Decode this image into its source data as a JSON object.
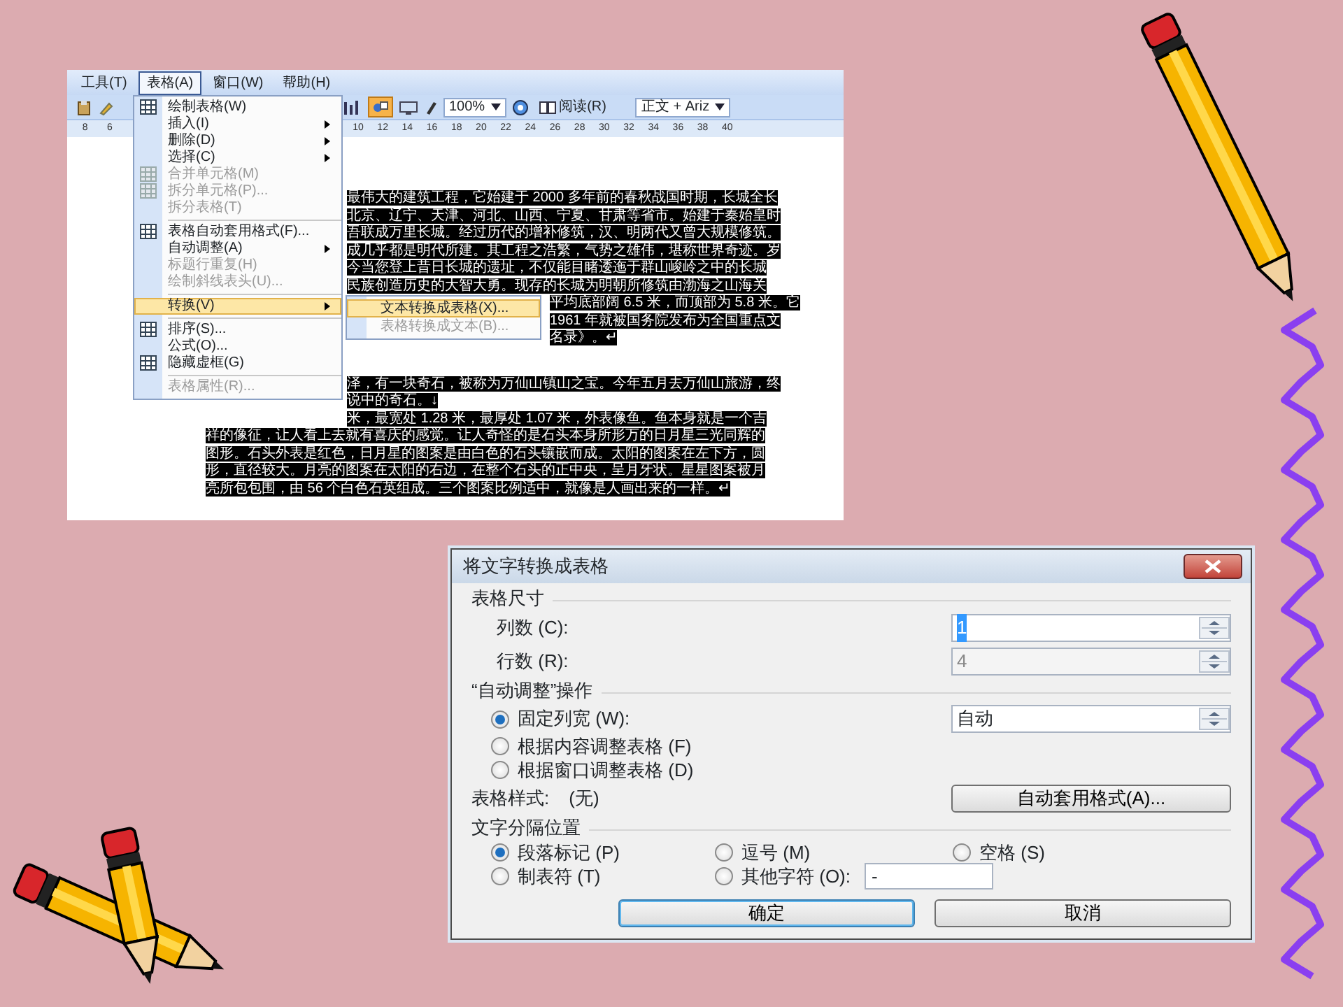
{
  "word_window": {
    "menu_bar": [
      {
        "label": "工具(T)",
        "selected": false
      },
      {
        "label": "表格(A)",
        "selected": true
      },
      {
        "label": "窗口(W)",
        "selected": false
      },
      {
        "label": "帮助(H)",
        "selected": false
      }
    ],
    "toolbar": {
      "zoom": "100%",
      "read_button": "阅读(R)",
      "style_field": "正文 + Ariz"
    },
    "ruler": {
      "left_ticks": [
        "8",
        "6"
      ],
      "ticks": [
        "10",
        "12",
        "14",
        "16",
        "18",
        "20",
        "22",
        "24",
        "26",
        "28",
        "30",
        "32",
        "34",
        "36",
        "38",
        "40"
      ]
    },
    "document": {
      "paragraphs": [
        {
          "lines": [
            {
              "kind": "beside_menu",
              "text": "最伟大的建筑工程，它始建于 2000 多年前的春秋战国时期，长城全长"
            },
            {
              "kind": "beside_menu",
              "text": "北京、辽宁、天津、河北、山西、宁夏、甘肃等省市。始建于秦始皇时"
            },
            {
              "kind": "beside_menu",
              "text": "吾联成万里长城。经过历代的增补修筑，汉、明两代又曾大规模修筑。"
            },
            {
              "kind": "beside_menu",
              "text": "成几乎都是明代所建。其工程之浩繁，气势之雄伟，堪称世界奇迹。岁"
            },
            {
              "kind": "beside_menu",
              "text": "今当您登上昔日长城的遗址，不仅能目睹逶迤于群山峻岭之中的长城"
            },
            {
              "kind": "beside_menu",
              "text": "民族创造历史的大智大勇。现存的长城为明朝所修筑由渤海之山海关"
            },
            {
              "kind": "beside_submenu",
              "text": "平均底部阔 6.5 米，而顶部为 5.8 米。它"
            },
            {
              "kind": "beside_submenu",
              "text": "1961 年就被国务院发布为全国重点文"
            },
            {
              "kind": "beside_submenu",
              "text": "名录》。↵"
            }
          ]
        },
        {
          "lines": [
            {
              "kind": "beside_menu",
              "text": "泽，有一块奇石，被称为万仙山镇山之宝。今年五月去万仙山旅游，终"
            },
            {
              "kind": "beside_menu",
              "text": "说中的奇石。↓"
            },
            {
              "kind": "beside_menu",
              "text": "米，最宽处 1.28 米，最厚处 1.07 米，外表像鱼。鱼本身就是一个吉"
            },
            {
              "kind": "full",
              "text": "祥的像征，让人看上去就有喜庆的感觉。让人奇怪的是石头本身所形万的日月星三光同辉的"
            },
            {
              "kind": "full",
              "text": "图形。石头外表是红色，日月星的图案是由白色的石头镶嵌而成。太阳的图案在左下方，圆"
            },
            {
              "kind": "full",
              "text": "形，直径较大。月亮的图案在太阳的右边，在整个石头的正中央，呈月牙状。星星图案被月"
            },
            {
              "kind": "full",
              "text": "亮所包包围，由 56 个白色石英组成。三个图案比例适中，就像是人画出来的一样。↵"
            }
          ]
        }
      ]
    },
    "menu": {
      "items": [
        {
          "kind": "icon_item",
          "label": "绘制表格(W)",
          "disabled": false,
          "submenu": false,
          "selected": false
        },
        {
          "kind": "item",
          "label": "插入(I)",
          "disabled": false,
          "submenu": true,
          "selected": false
        },
        {
          "kind": "item",
          "label": "删除(D)",
          "disabled": false,
          "submenu": true,
          "selected": false
        },
        {
          "kind": "item",
          "label": "选择(C)",
          "disabled": false,
          "submenu": true,
          "selected": false
        },
        {
          "kind": "icon_item",
          "label": "合并单元格(M)",
          "disabled": true,
          "submenu": false,
          "selected": false
        },
        {
          "kind": "icon_item",
          "label": "拆分单元格(P)...",
          "disabled": true,
          "submenu": false,
          "selected": false
        },
        {
          "kind": "item",
          "label": "拆分表格(T)",
          "disabled": true,
          "submenu": false,
          "selected": false
        },
        {
          "kind": "separator"
        },
        {
          "kind": "icon_item",
          "label": "表格自动套用格式(F)...",
          "disabled": false,
          "submenu": false,
          "selected": false
        },
        {
          "kind": "item",
          "label": "自动调整(A)",
          "disabled": false,
          "submenu": true,
          "selected": false
        },
        {
          "kind": "item",
          "label": "标题行重复(H)",
          "disabled": true,
          "submenu": false,
          "selected": false
        },
        {
          "kind": "item",
          "label": "绘制斜线表头(U)...",
          "disabled": true,
          "submenu": false,
          "selected": false
        },
        {
          "kind": "separator"
        },
        {
          "kind": "item",
          "label": "转换(V)",
          "disabled": false,
          "submenu": true,
          "selected": true
        },
        {
          "kind": "separator"
        },
        {
          "kind": "icon_item",
          "label": "排序(S)...",
          "disabled": false,
          "submenu": false,
          "selected": false
        },
        {
          "kind": "item",
          "label": "公式(O)...",
          "disabled": false,
          "submenu": false,
          "selected": false
        },
        {
          "kind": "icon_item",
          "label": "隐藏虚框(G)",
          "disabled": false,
          "submenu": false,
          "selected": false
        },
        {
          "kind": "separator"
        },
        {
          "kind": "item",
          "label": "表格属性(R)...",
          "disabled": true,
          "submenu": false,
          "selected": false
        }
      ]
    },
    "submenu": {
      "items": [
        {
          "label": "文本转换成表格(X)...",
          "disabled": false,
          "selected": true
        },
        {
          "label": "表格转换成文本(B)...",
          "disabled": true,
          "selected": false
        }
      ]
    }
  },
  "dialog": {
    "title": "将文字转换成表格",
    "size_section": {
      "heading": "表格尺寸",
      "fields": [
        {
          "label": "列数 (C):",
          "value": "1",
          "disabled": false,
          "value_highlighted": true
        },
        {
          "label": "行数 (R):",
          "value": "4",
          "disabled": true,
          "value_highlighted": false
        }
      ]
    },
    "autofit_section": {
      "heading": "“自动调整”操作",
      "options": [
        {
          "label": "固定列宽 (W):",
          "selected": true,
          "value": "自动"
        },
        {
          "label": "根据内容调整表格 (F)",
          "selected": false
        },
        {
          "label": "根据窗口调整表格 (D)",
          "selected": false
        }
      ]
    },
    "table_style": {
      "label": "表格样式:",
      "value": "(无)",
      "button": "自动套用格式(A)..."
    },
    "separator_section": {
      "heading": "文字分隔位置",
      "options": [
        {
          "label": "段落标记 (P)",
          "selected": true
        },
        {
          "label": "逗号 (M)",
          "selected": false
        },
        {
          "label": "空格 (S)",
          "selected": false
        },
        {
          "label": "制表符 (T)",
          "selected": false
        },
        {
          "label": "其他字符 (O):",
          "selected": false,
          "value": "-"
        }
      ]
    },
    "buttons": [
      {
        "label": "确定",
        "default": true
      },
      {
        "label": "取消",
        "default": false
      }
    ]
  }
}
